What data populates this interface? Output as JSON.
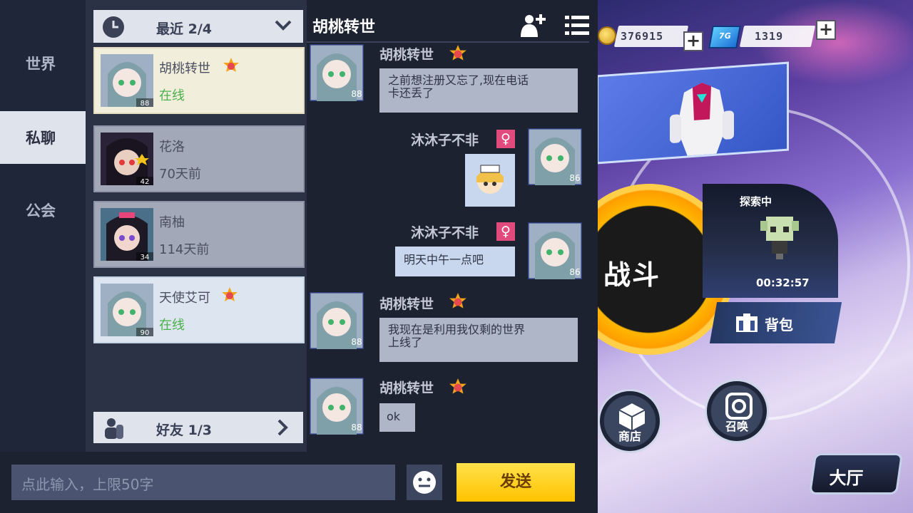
{
  "nav": {
    "world": "世界",
    "private": "私聊",
    "guild": "公会"
  },
  "recent": {
    "label": "最近",
    "count": "2/4"
  },
  "friends": {
    "label": "好友",
    "count": "1/3"
  },
  "contacts": [
    {
      "name": "胡桃转世",
      "status": "在线",
      "level": "88"
    },
    {
      "name": "花洛",
      "status": "70天前",
      "level": "42"
    },
    {
      "name": "南柚",
      "status": "114天前",
      "level": "34"
    },
    {
      "name": "天使艾可",
      "status": "在线",
      "level": "90"
    }
  ],
  "conversation": {
    "title": "胡桃转世"
  },
  "messages": [
    {
      "sender": "胡桃转世",
      "text_line1": "之前想注册又忘了,现在电话",
      "text_line2": "卡还丢了",
      "level": "88"
    },
    {
      "sender": "沐沐子不非",
      "gender": "♀",
      "level": "86"
    },
    {
      "sender": "沐沐子不非",
      "gender": "♀",
      "text": "明天中午一点吧",
      "level": "86"
    },
    {
      "sender": "胡桃转世",
      "text_line1": "我现在是利用我仅剩的世界",
      "text_line2": "上线了",
      "level": "88"
    },
    {
      "sender": "胡桃转世",
      "text": "ok",
      "level": "88"
    }
  ],
  "input": {
    "placeholder": "点此输入，上限50字",
    "send": "发送"
  },
  "game": {
    "gold": "376915",
    "gems": "1319",
    "gem_icon_text": "7G",
    "battle": "战斗",
    "exploring": "探索中",
    "timer": "00:32:57",
    "bag": "背包",
    "shop": "商店",
    "summon": "召唤",
    "hall": "大厅"
  },
  "colors": {
    "send": "#ffc300",
    "online": "#4bb04b",
    "female": "#e14a7c"
  }
}
